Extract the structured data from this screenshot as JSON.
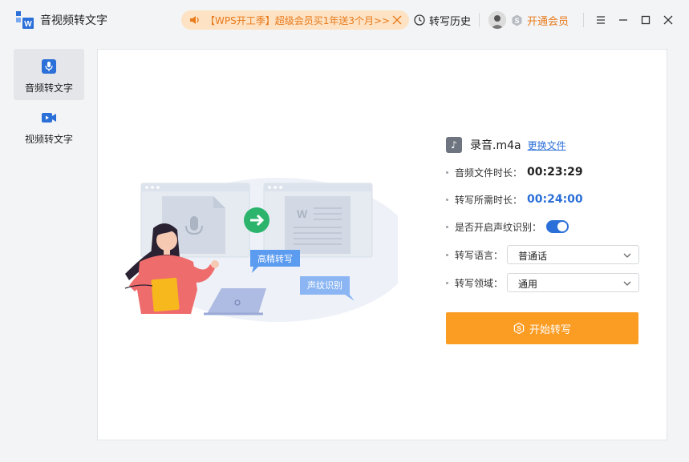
{
  "app": {
    "title": "音视频转文字",
    "logo_icon": "app-logo-icon"
  },
  "promo": {
    "text": "【WPS开工季】超级会员买1年送3个月>>",
    "icon": "speaker-icon"
  },
  "header": {
    "history_label": "转写历史",
    "vip_label": "开通会员"
  },
  "sidebar": {
    "items": [
      {
        "label": "音频转文字",
        "icon": "microphone-icon",
        "active": true
      },
      {
        "label": "视频转文字",
        "icon": "video-camera-icon",
        "active": false
      }
    ]
  },
  "illustration": {
    "bubble_hd": "高精转写",
    "bubble_voiceprint": "声纹识别"
  },
  "panel": {
    "file_name": "录音.m4a",
    "change_file": "更换文件",
    "duration_label": "音频文件时长：",
    "duration_value": "00:23:29",
    "needed_label": "转写所需时长：",
    "needed_value": "00:24:00",
    "voiceprint_label": "是否开启声纹识别：",
    "voiceprint_on": true,
    "language_label": "转写语言：",
    "language_value": "普通话",
    "domain_label": "转写领域：",
    "domain_value": "通用",
    "start_label": "开始转写"
  },
  "colors": {
    "accent": "#2b6fd8",
    "orange": "#fb9c23",
    "promo_bg": "#fde2c3",
    "promo_text": "#e87a1c"
  }
}
